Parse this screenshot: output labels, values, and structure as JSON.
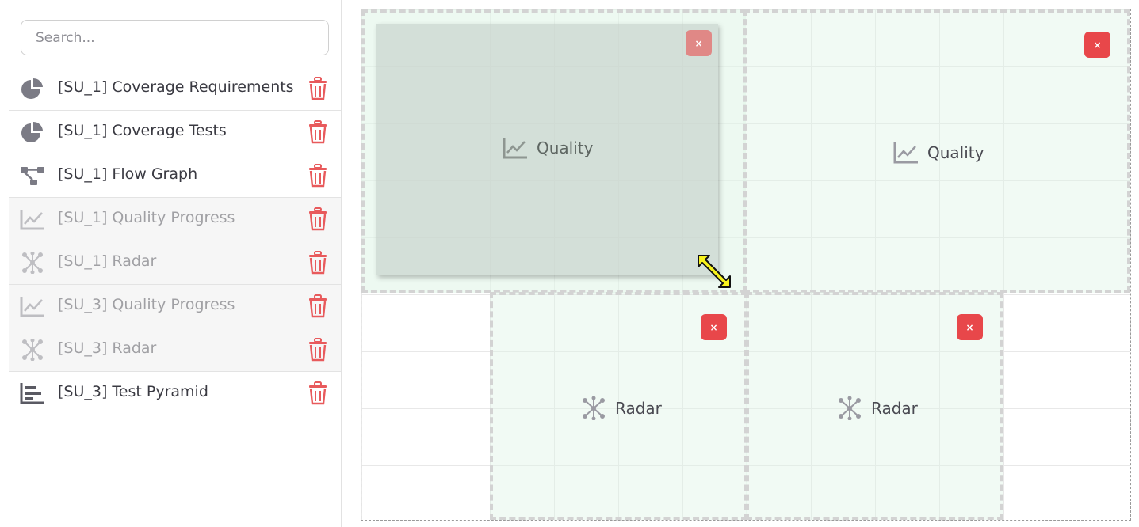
{
  "search": {
    "placeholder": "Search..."
  },
  "sidebar": {
    "items": [
      {
        "label": "[SU_1] Coverage Requirements",
        "icon": "pie-chart-icon",
        "dim": false
      },
      {
        "label": "[SU_1] Coverage Tests",
        "icon": "pie-chart-icon",
        "dim": false
      },
      {
        "label": "[SU_1] Flow Graph",
        "icon": "flow-graph-icon",
        "dim": false
      },
      {
        "label": "[SU_1] Quality Progress",
        "icon": "line-chart-icon",
        "dim": true
      },
      {
        "label": "[SU_1] Radar",
        "icon": "radar-icon",
        "dim": true
      },
      {
        "label": "[SU_3] Quality Progress",
        "icon": "line-chart-icon",
        "dim": true
      },
      {
        "label": "[SU_3] Radar",
        "icon": "radar-icon",
        "dim": true
      },
      {
        "label": "[SU_3] Test Pyramid",
        "icon": "bar-chart-icon",
        "dim": false
      }
    ]
  },
  "canvas": {
    "close_label": "×",
    "ghost": {
      "label": "Quality",
      "icon": "line-chart-icon"
    },
    "widgets": [
      {
        "label": "Quality",
        "icon": "line-chart-icon"
      },
      {
        "label": "Radar",
        "icon": "radar-icon"
      },
      {
        "label": "Radar",
        "icon": "radar-icon"
      }
    ]
  },
  "colors": {
    "accent_red": "#e8474a",
    "trash_red": "#e85a5c",
    "widget_bg": "#e1f3e6"
  }
}
